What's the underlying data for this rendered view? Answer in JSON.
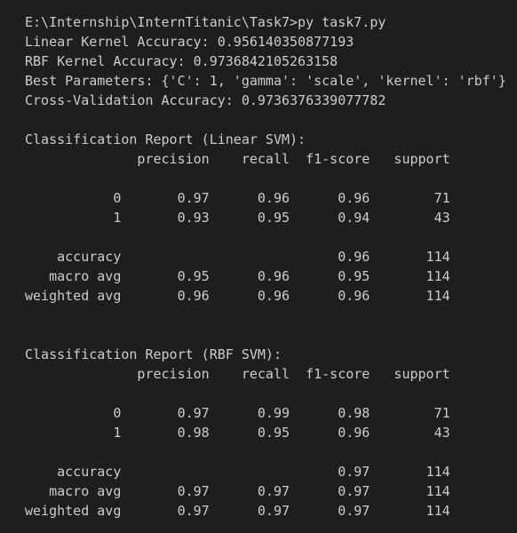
{
  "terminal": {
    "lines": [
      "E:\\Internship\\InternTitanic\\Task7>py task7.py",
      "Linear Kernel Accuracy: 0.956140350877193",
      "RBF Kernel Accuracy: 0.9736842105263158",
      "Best Parameters: {'C': 1, 'gamma': 'scale', 'kernel': 'rbf'}",
      "Cross-Validation Accuracy: 0.9736376339077782",
      "",
      "Classification Report (Linear SVM):",
      "              precision    recall  f1-score   support",
      "",
      "           0       0.97      0.96      0.96        71",
      "           1       0.93      0.95      0.94        43",
      "",
      "    accuracy                           0.96       114",
      "   macro avg       0.95      0.96      0.95       114",
      "weighted avg       0.96      0.96      0.96       114",
      "",
      "",
      "Classification Report (RBF SVM):",
      "              precision    recall  f1-score   support",
      "",
      "           0       0.97      0.99      0.98        71",
      "           1       0.98      0.95      0.96        43",
      "",
      "    accuracy                           0.97       114",
      "   macro avg       0.97      0.97      0.97       114",
      "weighted avg       0.97      0.97      0.97       114"
    ]
  },
  "colors": {
    "background": "#1e1e1e",
    "text": "#cccccc"
  }
}
